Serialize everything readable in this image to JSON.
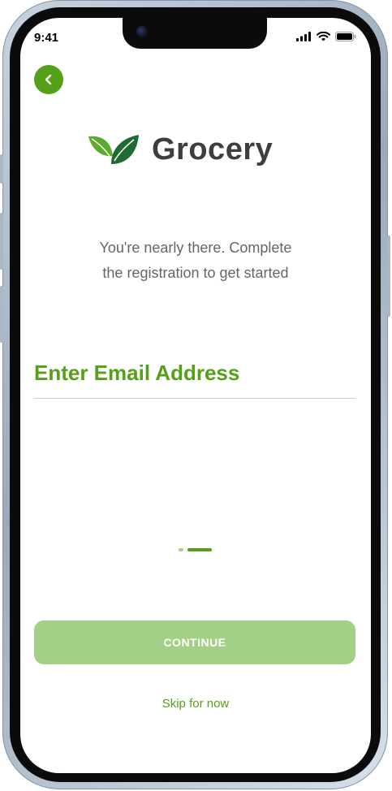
{
  "status_bar": {
    "time": "9:41"
  },
  "brand": {
    "name": "Grocery"
  },
  "subtitle": {
    "line1": "You're nearly there. Complete",
    "line2": "the registration to get started"
  },
  "email": {
    "label": "Enter Email Address",
    "value": ""
  },
  "pagination": {
    "current": 2,
    "total": 2
  },
  "buttons": {
    "continue": "CONTINUE",
    "skip": "Skip for now"
  },
  "icons": {
    "back": "chevron-left-icon",
    "logo": "leaf-icon"
  },
  "colors": {
    "accent": "#54a018",
    "button_disabled": "#a4cf86",
    "text_muted": "#666666",
    "brand_text": "#3e3e3e",
    "leaf_light": "#5cab2c",
    "leaf_dark": "#1f6b33"
  }
}
